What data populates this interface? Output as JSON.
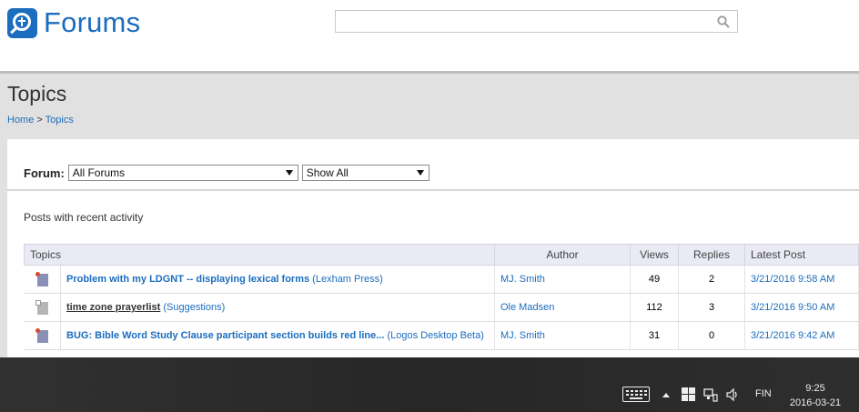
{
  "header": {
    "logo_text": "Forums",
    "search_placeholder": ""
  },
  "page": {
    "title": "Topics",
    "breadcrumb": {
      "home": "Home",
      "separator": " > ",
      "current": "Topics"
    }
  },
  "filters": {
    "forum_label": "Forum:",
    "forum_selected": "All Forums",
    "show_selected": "Show All"
  },
  "recent_label": "Posts with recent activity",
  "table": {
    "headers": {
      "topics": "Topics",
      "author": "Author",
      "views": "Views",
      "replies": "Replies",
      "latest": "Latest Post"
    },
    "rows": [
      {
        "title": "Problem with my LDGNT -- displaying lexical forms",
        "forum": "(Lexham Press)",
        "author": "MJ. Smith",
        "views": "49",
        "replies": "2",
        "latest": "3/21/2016 9:58 AM",
        "unread": true
      },
      {
        "title": "time zone prayerlist",
        "forum": "(Suggestions)",
        "author": "Ole Madsen",
        "views": "112",
        "replies": "3",
        "latest": "3/21/2016 9:50 AM",
        "unread": false
      },
      {
        "title": "BUG: Bible Word Study Clause participant section builds red line...",
        "forum": "(Logos Desktop Beta)",
        "author": "MJ. Smith",
        "views": "31",
        "replies": "0",
        "latest": "3/21/2016 9:42 AM",
        "unread": true
      }
    ]
  },
  "taskbar": {
    "language": "FIN",
    "time": "9:25",
    "date": "2016-03-21"
  },
  "icons": {
    "logo": "forums-logo-icon",
    "search": "search-icon",
    "topic": "topic-document-icon",
    "keyboard": "keyboard-icon",
    "tray_up": "chevron-up-icon",
    "windows": "windows-icon",
    "network": "network-icon",
    "volume": "volume-icon"
  },
  "colors": {
    "brand": "#1b6dbf",
    "band": "#e1e1e1",
    "table_header": "#e9eaf4",
    "unread_dot": "#d84a2a"
  }
}
